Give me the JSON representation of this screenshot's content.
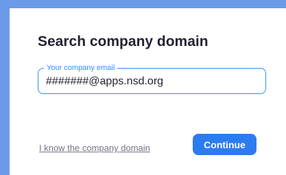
{
  "dialog": {
    "title": "Search company domain",
    "email_field": {
      "label": "Your company email",
      "value": "#######@apps.nsd.org"
    },
    "link_text": "I know the company domain",
    "continue_label": "Continue"
  },
  "colors": {
    "accent": "#2d8cff",
    "button": "#2d7bf0",
    "backdrop": "#6b9be8"
  }
}
